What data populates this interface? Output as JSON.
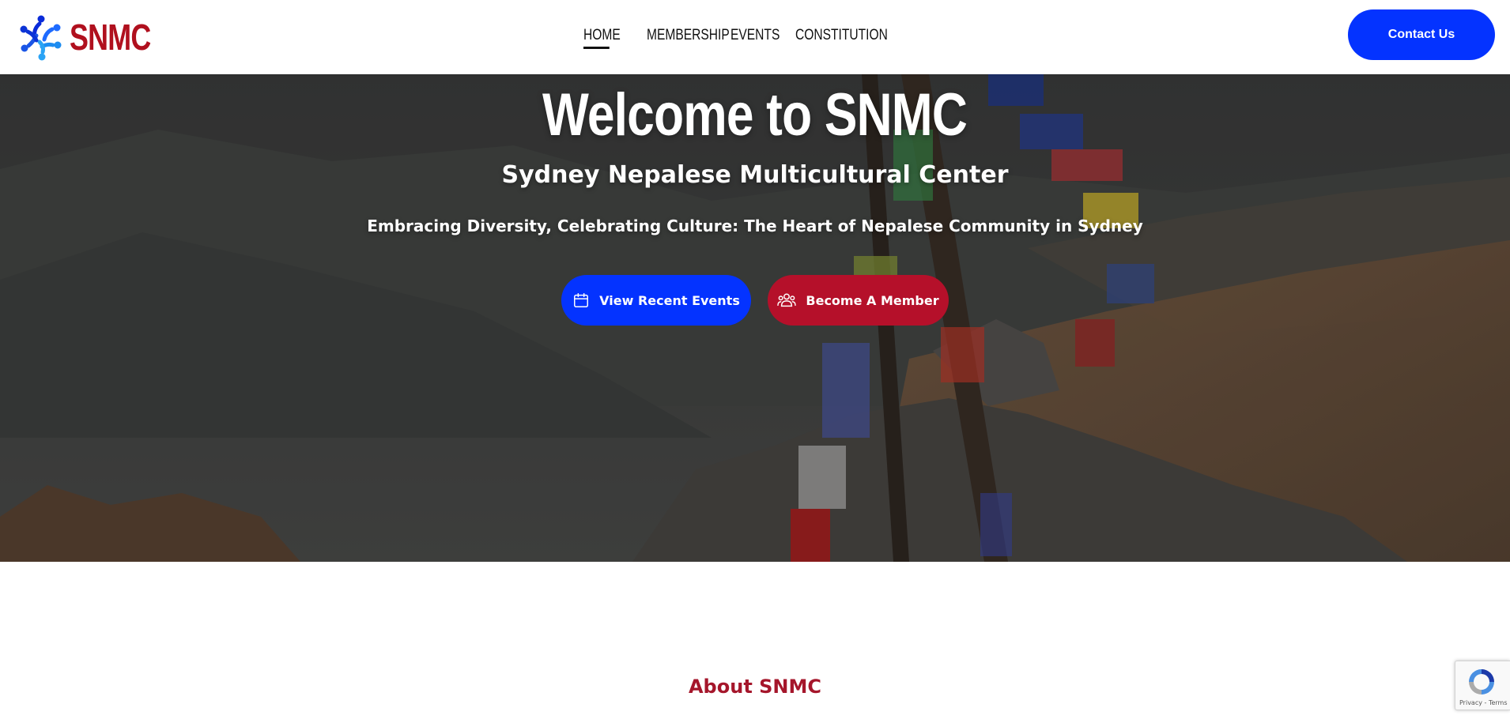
{
  "brand": {
    "name": "SNMC",
    "primary_blue": "#0433ff",
    "primary_red": "#b5102a",
    "logo_icon": "people-circle-logo"
  },
  "nav": {
    "items": [
      {
        "label": "HOME",
        "active": true
      },
      {
        "label": "MEMBERSHIP",
        "active": false
      },
      {
        "label": "EVENTS",
        "active": false
      },
      {
        "label": "CONSTITUTION",
        "active": false
      }
    ],
    "contact_label": "Contact Us"
  },
  "hero": {
    "title": "Welcome to SNMC",
    "subtitle": "Sydney Nepalese Multicultural Center",
    "tagline": "Embracing Diversity, Celebrating Culture: The Heart of Nepalese Community in Sydney",
    "buttons": [
      {
        "label": "View Recent Events",
        "icon": "calendar-icon",
        "color": "#0433ff"
      },
      {
        "label": "Become A Member",
        "icon": "users-icon",
        "color": "#b5102a"
      }
    ],
    "background": "mountain-ridge-prayer-flags"
  },
  "about": {
    "heading": "About SNMC"
  },
  "recaptcha": {
    "links": "Privacy - Terms"
  }
}
